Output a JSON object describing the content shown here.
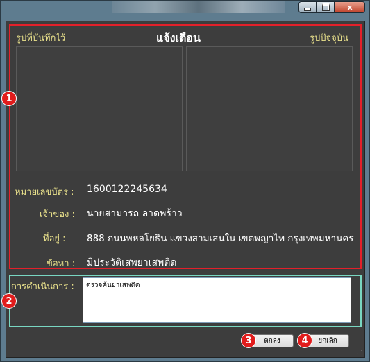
{
  "window": {
    "controls": {
      "minimize": "minimize",
      "maximize": "maximize",
      "close": "x"
    }
  },
  "dialog": {
    "title": "แจ้งเตือน",
    "saved_photo_label": "รูปที่บันทึกไว้",
    "current_photo_label": "รูปปัจจุบัน"
  },
  "info": {
    "card_number_label": "หมายเลขบัตร :",
    "card_number_value": "1600122245634",
    "owner_label": "เจ้าของ :",
    "owner_value": "นายสามารถ ลาดพร้าว",
    "address_label": "ที่อยู่ :",
    "address_value": "888 ถนนพหลโยธิน แขวงสามเสนใน เขตพญาไท กรุงเทพมหานคร",
    "charge_label": "ข้อหา :",
    "charge_value": "มีประวัติเสพยาเสพติด"
  },
  "action": {
    "label": "การดำเนินการ :",
    "value": "ตรวจค้นยาเสพติด"
  },
  "buttons": {
    "ok": "ตกลง",
    "cancel": "ยกเลิก"
  },
  "markers": [
    "1",
    "2",
    "3",
    "4"
  ],
  "colors": {
    "section_highlight": "#e3202a",
    "action_highlight": "#79d7c2",
    "label_color": "#e8e08b",
    "marker": "#e11c1c"
  }
}
